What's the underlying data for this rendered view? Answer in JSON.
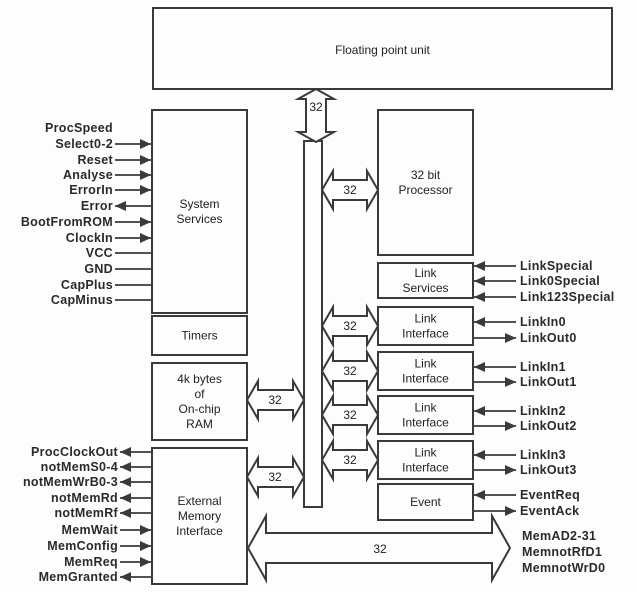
{
  "blocks": {
    "fpu": [
      "Floating point unit"
    ],
    "system_services": [
      "System",
      "Services"
    ],
    "timers": [
      "Timers"
    ],
    "ram": [
      "4k bytes",
      "of",
      "On-chip",
      "RAM"
    ],
    "emi": [
      "External",
      "Memory",
      "Interface"
    ],
    "processor": [
      "32 bit",
      "Processor"
    ],
    "link_services": [
      "Link",
      "Services"
    ],
    "link_interface_0": [
      "Link",
      "Interface"
    ],
    "link_interface_1": [
      "Link",
      "Interface"
    ],
    "link_interface_2": [
      "Link",
      "Interface"
    ],
    "link_interface_3": [
      "Link",
      "Interface"
    ],
    "event": [
      "Event"
    ]
  },
  "bus_width_label": "32",
  "signals": {
    "system_services": [
      {
        "label": "ProcSpeed",
        "dir": "none"
      },
      {
        "label": "Select0-2",
        "dir": "in"
      },
      {
        "label": "Reset",
        "dir": "in"
      },
      {
        "label": "Analyse",
        "dir": "in"
      },
      {
        "label": "ErrorIn",
        "dir": "in"
      },
      {
        "label": "Error",
        "dir": "out"
      },
      {
        "label": "BootFromROM",
        "dir": "in"
      },
      {
        "label": "ClockIn",
        "dir": "in"
      },
      {
        "label": "VCC",
        "dir": "line"
      },
      {
        "label": "GND",
        "dir": "line"
      },
      {
        "label": "CapPlus",
        "dir": "line"
      },
      {
        "label": "CapMinus",
        "dir": "line"
      }
    ],
    "emi": [
      {
        "label": "ProcClockOut",
        "dir": "out"
      },
      {
        "label": "notMemS0-4",
        "dir": "out"
      },
      {
        "label": "notMemWrB0-3",
        "dir": "out"
      },
      {
        "label": "notMemRd",
        "dir": "out"
      },
      {
        "label": "notMemRf",
        "dir": "out"
      },
      {
        "label": "MemWait",
        "dir": "in"
      },
      {
        "label": "MemConfig",
        "dir": "in"
      },
      {
        "label": "MemReq",
        "dir": "in"
      },
      {
        "label": "MemGranted",
        "dir": "out"
      }
    ],
    "right": [
      {
        "label": "LinkSpecial",
        "dir": "in"
      },
      {
        "label": "Link0Special",
        "dir": "in"
      },
      {
        "label": "Link123Special",
        "dir": "in"
      },
      {
        "label": "LinkIn0",
        "dir": "in"
      },
      {
        "label": "LinkOut0",
        "dir": "out"
      },
      {
        "label": "LinkIn1",
        "dir": "in"
      },
      {
        "label": "LinkOut1",
        "dir": "out"
      },
      {
        "label": "LinkIn2",
        "dir": "in"
      },
      {
        "label": "LinkOut2",
        "dir": "out"
      },
      {
        "label": "LinkIn3",
        "dir": "in"
      },
      {
        "label": "LinkOut3",
        "dir": "out"
      },
      {
        "label": "EventReq",
        "dir": "in"
      },
      {
        "label": "EventAck",
        "dir": "out"
      }
    ],
    "memory_bus": [
      "MemAD2-31",
      "MemnotRfD1",
      "MemnotWrD0"
    ]
  }
}
